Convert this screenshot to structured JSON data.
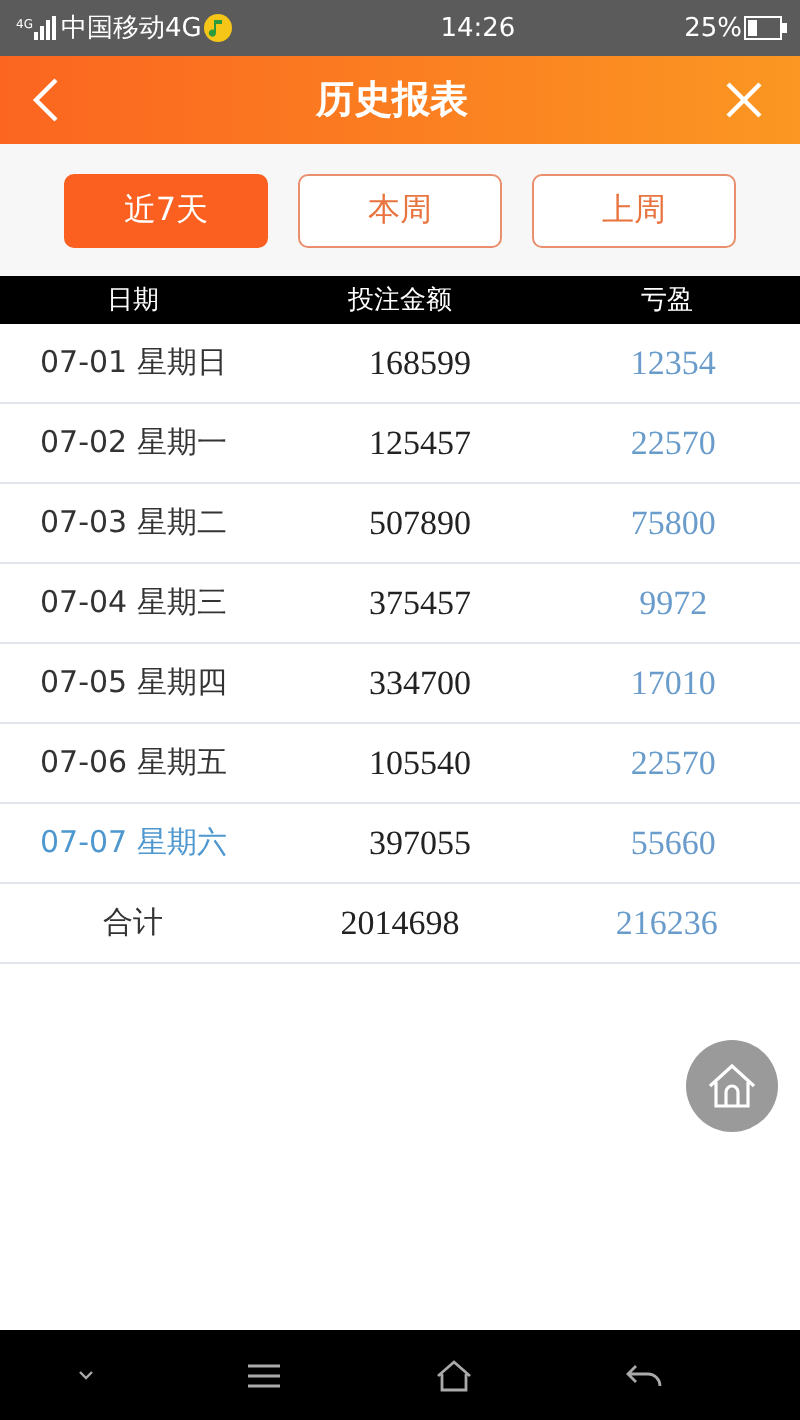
{
  "status_bar": {
    "network": "4G",
    "carrier": "中国移动4G",
    "time": "14:26",
    "battery": "25%"
  },
  "header": {
    "title": "历史报表"
  },
  "tabs": [
    {
      "label": "近7天",
      "selected": true
    },
    {
      "label": "本周",
      "selected": false
    },
    {
      "label": "上周",
      "selected": false
    }
  ],
  "table": {
    "columns": [
      "日期",
      "投注金额",
      "亏盈"
    ],
    "rows": [
      {
        "date": "07-01 星期日",
        "amount": "168599",
        "profit": "12354",
        "current": false
      },
      {
        "date": "07-02 星期一",
        "amount": "125457",
        "profit": "22570",
        "current": false
      },
      {
        "date": "07-03 星期二",
        "amount": "507890",
        "profit": "75800",
        "current": false
      },
      {
        "date": "07-04 星期三",
        "amount": "375457",
        "profit": "9972",
        "current": false
      },
      {
        "date": "07-05 星期四",
        "amount": "334700",
        "profit": "17010",
        "current": false
      },
      {
        "date": "07-06 星期五",
        "amount": "105540",
        "profit": "22570",
        "current": false
      },
      {
        "date": "07-07 星期六",
        "amount": "397055",
        "profit": "55660",
        "current": true
      }
    ],
    "total": {
      "label": "合计",
      "amount": "2014698",
      "profit": "216236"
    }
  }
}
